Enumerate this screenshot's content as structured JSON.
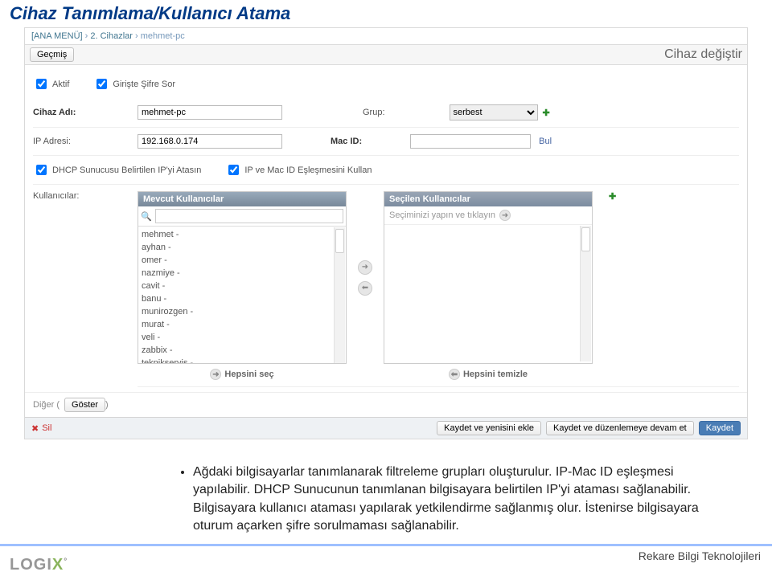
{
  "page_title": "Cihaz Tanımlama/Kullanıcı Atama",
  "breadcrumb": {
    "home": "[ANA MENÜ]",
    "sep": "›",
    "section": "2. Cihazlar",
    "item": "mehmet-pc"
  },
  "header": {
    "history_btn": "Geçmiş",
    "right_title": "Cihaz değiştir"
  },
  "checks": {
    "aktif": "Aktif",
    "giriste_sifre": "Girişte Şifre Sor",
    "dhcp": "DHCP Sunucusu Belirtilen IP'yi Atasın",
    "ipmac": "IP ve Mac ID Eşleşmesini Kullan"
  },
  "labels": {
    "cihaz_adi": "Cihaz Adı:",
    "grup": "Grup:",
    "ip": "IP Adresi:",
    "mac": "Mac ID:",
    "kullanicilar": "Kullanıcılar:",
    "diger": "Diğer",
    "bul": "Bul",
    "goster": "Göster"
  },
  "values": {
    "cihaz_adi": "mehmet-pc",
    "ip": "192.168.0.174",
    "mac": "",
    "grup_selected": "serbest"
  },
  "userlist": {
    "available_title": "Mevcut Kullanıcılar",
    "selected_title": "Seçilen Kullanıcılar",
    "hint": "Seçiminizi yapın ve tıklayın",
    "select_all": "Hepsini seç",
    "clear_all": "Hepsini temizle",
    "items": [
      "mehmet -",
      "ayhan -",
      "omer -",
      "nazmiye -",
      "cavit -",
      "banu -",
      "munirozgen -",
      "murat -",
      "veli -",
      "zabbix -",
      "teknikservis -"
    ]
  },
  "footer": {
    "sil": "Sil",
    "save_add": "Kaydet ve yenisini ekle",
    "save_cont": "Kaydet ve düzenlemeye devam et",
    "save": "Kaydet"
  },
  "notes": [
    "Ağdaki bilgisayarlar tanımlanarak filtreleme grupları oluşturulur. IP-Mac ID eşleşmesi yapılabilir. DHCP Sunucunun tanımlanan bilgisayara belirtilen IP'yi ataması sağlanabilir. Bilgisayara kullanıcı ataması yapılarak yetkilendirme sağlanmış olur. İstenirse bilgisayara oturum açarken şifre sorulmaması sağlanabilir."
  ],
  "brand": "Rekare Bilgi Teknolojileri",
  "logo": "LOGIX"
}
